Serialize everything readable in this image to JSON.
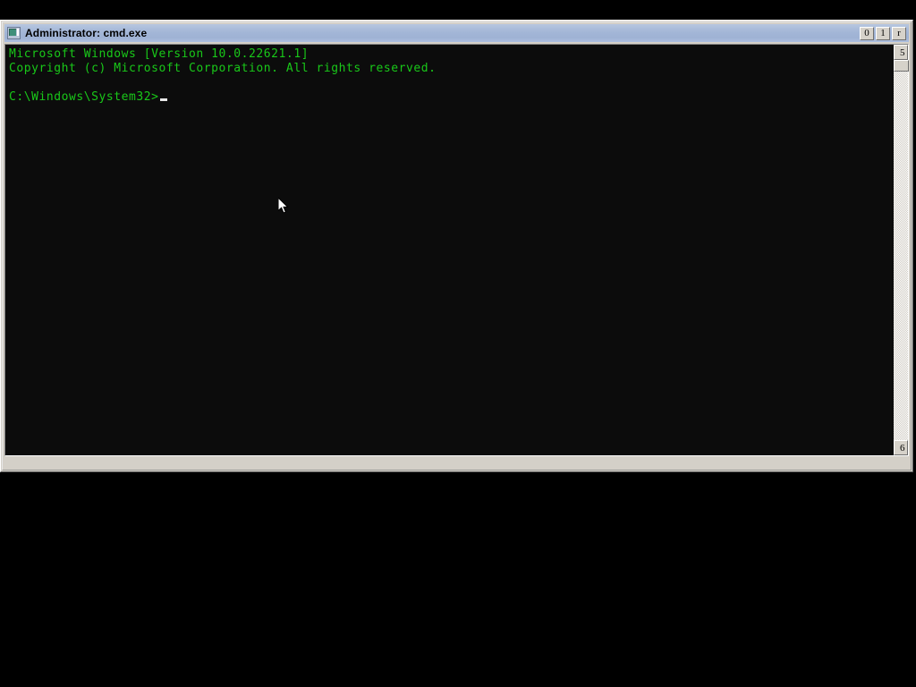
{
  "window": {
    "title": "Administrator: cmd.exe",
    "icon": "cmd-console-icon",
    "buttons": [
      {
        "name": "minimize-button",
        "glyph": "0"
      },
      {
        "name": "maximize-button",
        "glyph": "1"
      },
      {
        "name": "close-button",
        "glyph": "r"
      }
    ]
  },
  "console": {
    "lines": [
      "Microsoft Windows [Version 10.0.22621.1]",
      "Copyright (c) Microsoft Corporation. All rights reserved.",
      ""
    ],
    "prompt": "C:\\Windows\\System32>",
    "input": "",
    "cursor": "block"
  },
  "scrollbar": {
    "up_glyph": "5",
    "down_glyph": "6"
  },
  "colors": {
    "console_background": "#0c0c0c",
    "console_text": "#19c819",
    "title_bar": "#a3b6d7",
    "window_face": "#d4d0c8",
    "cursor": "#e8e8e8",
    "desktop": "#000000"
  }
}
